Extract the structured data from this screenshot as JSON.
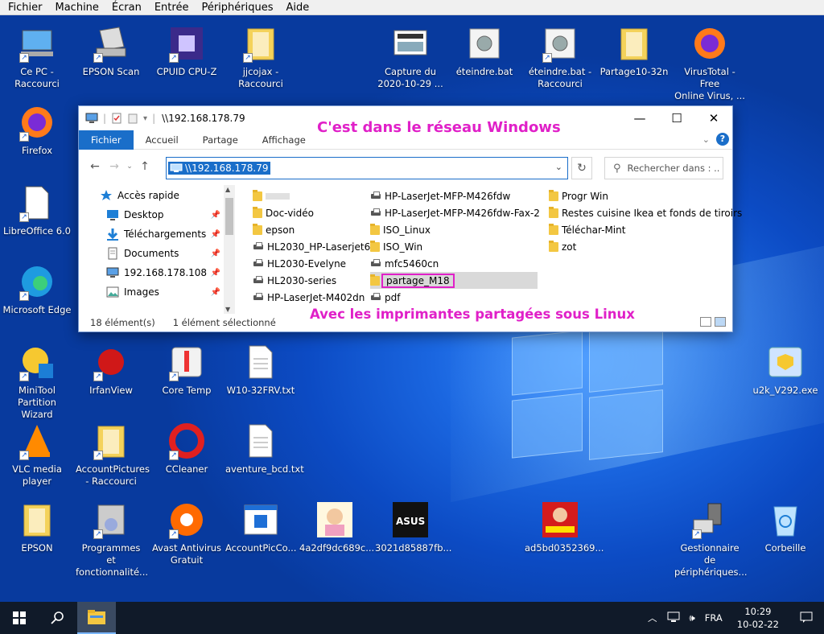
{
  "vm_menu": [
    "Fichier",
    "Machine",
    "Écran",
    "Entrée",
    "Périphériques",
    "Aide"
  ],
  "desktop_icons": [
    {
      "label": "Ce PC -\nRaccourci",
      "kind": "pc"
    },
    {
      "label": "EPSON Scan",
      "kind": "scanner"
    },
    {
      "label": "CPUID CPU-Z",
      "kind": "cpuz"
    },
    {
      "label": "jjcojax -\nRaccourci",
      "kind": "folder"
    },
    {
      "label": "Capture du\n2020-10-29 ...",
      "kind": "capture"
    },
    {
      "label": "éteindre.bat",
      "kind": "gear"
    },
    {
      "label": "éteindre.bat -\nRaccourci",
      "kind": "gear"
    },
    {
      "label": "Partage10-32n",
      "kind": "folder"
    },
    {
      "label": "VirusTotal - Free\nOnline Virus, ...",
      "kind": "firefox"
    },
    {
      "label": "Firefox",
      "kind": "firefox"
    },
    {
      "label": "LibreOffice 6.0",
      "kind": "libre"
    },
    {
      "label": "Microsoft Edge",
      "kind": "edge"
    },
    {
      "label": "MiniTool\nPartition Wizard",
      "kind": "minitool"
    },
    {
      "label": "IrfanView",
      "kind": "irfan"
    },
    {
      "label": "Core Temp",
      "kind": "coretemp"
    },
    {
      "label": "W10-32FRV.txt",
      "kind": "txt"
    },
    {
      "label": "u2k_V292.exe",
      "kind": "exe"
    },
    {
      "label": "VLC media\nplayer",
      "kind": "vlc"
    },
    {
      "label": "AccountPictures\n- Raccourci",
      "kind": "folder"
    },
    {
      "label": "CCleaner",
      "kind": "ccleaner"
    },
    {
      "label": "aventure_bcd.txt",
      "kind": "txt"
    },
    {
      "label": "EPSON",
      "kind": "folder"
    },
    {
      "label": "Programmes et\nfonctionnalité...",
      "kind": "programs"
    },
    {
      "label": "Avast Antivirus\nGratuit",
      "kind": "avast"
    },
    {
      "label": "AccountPicCo...",
      "kind": "window"
    },
    {
      "label": "4a2df9dc689c...",
      "kind": "picture"
    },
    {
      "label": "3021d85887fb...",
      "kind": "asus"
    },
    {
      "label": "ad5bd0352369...",
      "kind": "picture2"
    },
    {
      "label": "Gestionnaire de\npériphériques...",
      "kind": "devices"
    },
    {
      "label": "Corbeille",
      "kind": "recycle"
    }
  ],
  "explorer": {
    "title": "\\\\192.168.178.79",
    "annotation_top": "C'est dans le réseau Windows",
    "annotation_bottom": "Avec les imprimantes partagées sous Linux",
    "ribbon_tabs": [
      "Fichier",
      "Accueil",
      "Partage",
      "Affichage"
    ],
    "address": "\\\\192.168.178.79",
    "search_placeholder": "Rechercher dans : ...",
    "nav_items": [
      {
        "label": "Accès rapide",
        "icon": "star-icon",
        "pinned": false
      },
      {
        "label": "Desktop",
        "icon": "desktop-icon",
        "pinned": true
      },
      {
        "label": "Téléchargements",
        "icon": "download-icon",
        "pinned": true
      },
      {
        "label": "Documents",
        "icon": "documents-icon",
        "pinned": true
      },
      {
        "label": "192.168.178.108",
        "icon": "monitor-icon",
        "pinned": true
      },
      {
        "label": "Images",
        "icon": "images-icon",
        "pinned": true
      }
    ],
    "files": [
      {
        "name": "",
        "type": "folder",
        "col": 0,
        "row": 0
      },
      {
        "name": "Doc-vidéo",
        "type": "folder",
        "col": 0,
        "row": 1
      },
      {
        "name": "epson",
        "type": "folder",
        "col": 0,
        "row": 2
      },
      {
        "name": "HL2030_HP-Laserjet6",
        "type": "printer",
        "col": 0,
        "row": 3
      },
      {
        "name": "HL2030-Evelyne",
        "type": "printer",
        "col": 0,
        "row": 4
      },
      {
        "name": "HL2030-series",
        "type": "printer",
        "col": 0,
        "row": 5
      },
      {
        "name": "HP-LaserJet-M402dn",
        "type": "printer",
        "col": 0,
        "row": 6
      },
      {
        "name": "HP-LaserJet-MFP-M426fdw",
        "type": "printer",
        "col": 1,
        "row": 0
      },
      {
        "name": "HP-LaserJet-MFP-M426fdw-Fax-2",
        "type": "printer",
        "col": 1,
        "row": 1
      },
      {
        "name": "ISO_Linux",
        "type": "folder",
        "col": 1,
        "row": 2
      },
      {
        "name": "ISO_Win",
        "type": "folder",
        "col": 1,
        "row": 3
      },
      {
        "name": "mfc5460cn",
        "type": "printer",
        "col": 1,
        "row": 4
      },
      {
        "name": "partage_M18",
        "type": "folder",
        "col": 1,
        "row": 5,
        "selected": true
      },
      {
        "name": "pdf",
        "type": "printer",
        "col": 1,
        "row": 6
      },
      {
        "name": "Progr Win",
        "type": "folder",
        "col": 2,
        "row": 0
      },
      {
        "name": "Restes cuisine Ikea et fonds de tiroirs",
        "type": "folder",
        "col": 2,
        "row": 1
      },
      {
        "name": "Téléchar-Mint",
        "type": "folder",
        "col": 2,
        "row": 2
      },
      {
        "name": "zot",
        "type": "folder",
        "col": 2,
        "row": 3
      }
    ],
    "status_count": "18 élément(s)",
    "status_selection": "1 élément sélectionné"
  },
  "taskbar": {
    "language": "FRA",
    "time": "10:29",
    "date": "10-02-22"
  }
}
